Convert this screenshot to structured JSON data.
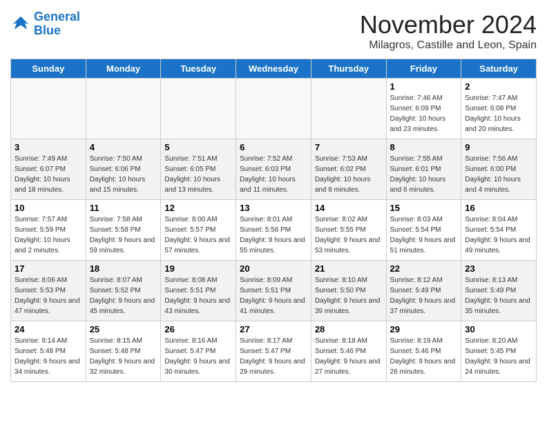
{
  "header": {
    "logo_line1": "General",
    "logo_line2": "Blue",
    "month": "November 2024",
    "location": "Milagros, Castille and Leon, Spain"
  },
  "weekdays": [
    "Sunday",
    "Monday",
    "Tuesday",
    "Wednesday",
    "Thursday",
    "Friday",
    "Saturday"
  ],
  "weeks": [
    {
      "shaded": false,
      "days": [
        {
          "number": "",
          "info": ""
        },
        {
          "number": "",
          "info": ""
        },
        {
          "number": "",
          "info": ""
        },
        {
          "number": "",
          "info": ""
        },
        {
          "number": "",
          "info": ""
        },
        {
          "number": "1",
          "info": "Sunrise: 7:46 AM\nSunset: 6:09 PM\nDaylight: 10 hours and 23 minutes."
        },
        {
          "number": "2",
          "info": "Sunrise: 7:47 AM\nSunset: 6:08 PM\nDaylight: 10 hours and 20 minutes."
        }
      ]
    },
    {
      "shaded": true,
      "days": [
        {
          "number": "3",
          "info": "Sunrise: 7:49 AM\nSunset: 6:07 PM\nDaylight: 10 hours and 18 minutes."
        },
        {
          "number": "4",
          "info": "Sunrise: 7:50 AM\nSunset: 6:06 PM\nDaylight: 10 hours and 15 minutes."
        },
        {
          "number": "5",
          "info": "Sunrise: 7:51 AM\nSunset: 6:05 PM\nDaylight: 10 hours and 13 minutes."
        },
        {
          "number": "6",
          "info": "Sunrise: 7:52 AM\nSunset: 6:03 PM\nDaylight: 10 hours and 11 minutes."
        },
        {
          "number": "7",
          "info": "Sunrise: 7:53 AM\nSunset: 6:02 PM\nDaylight: 10 hours and 8 minutes."
        },
        {
          "number": "8",
          "info": "Sunrise: 7:55 AM\nSunset: 6:01 PM\nDaylight: 10 hours and 6 minutes."
        },
        {
          "number": "9",
          "info": "Sunrise: 7:56 AM\nSunset: 6:00 PM\nDaylight: 10 hours and 4 minutes."
        }
      ]
    },
    {
      "shaded": false,
      "days": [
        {
          "number": "10",
          "info": "Sunrise: 7:57 AM\nSunset: 5:59 PM\nDaylight: 10 hours and 2 minutes."
        },
        {
          "number": "11",
          "info": "Sunrise: 7:58 AM\nSunset: 5:58 PM\nDaylight: 9 hours and 59 minutes."
        },
        {
          "number": "12",
          "info": "Sunrise: 8:00 AM\nSunset: 5:57 PM\nDaylight: 9 hours and 57 minutes."
        },
        {
          "number": "13",
          "info": "Sunrise: 8:01 AM\nSunset: 5:56 PM\nDaylight: 9 hours and 55 minutes."
        },
        {
          "number": "14",
          "info": "Sunrise: 8:02 AM\nSunset: 5:55 PM\nDaylight: 9 hours and 53 minutes."
        },
        {
          "number": "15",
          "info": "Sunrise: 8:03 AM\nSunset: 5:54 PM\nDaylight: 9 hours and 51 minutes."
        },
        {
          "number": "16",
          "info": "Sunrise: 8:04 AM\nSunset: 5:54 PM\nDaylight: 9 hours and 49 minutes."
        }
      ]
    },
    {
      "shaded": true,
      "days": [
        {
          "number": "17",
          "info": "Sunrise: 8:06 AM\nSunset: 5:53 PM\nDaylight: 9 hours and 47 minutes."
        },
        {
          "number": "18",
          "info": "Sunrise: 8:07 AM\nSunset: 5:52 PM\nDaylight: 9 hours and 45 minutes."
        },
        {
          "number": "19",
          "info": "Sunrise: 8:08 AM\nSunset: 5:51 PM\nDaylight: 9 hours and 43 minutes."
        },
        {
          "number": "20",
          "info": "Sunrise: 8:09 AM\nSunset: 5:51 PM\nDaylight: 9 hours and 41 minutes."
        },
        {
          "number": "21",
          "info": "Sunrise: 8:10 AM\nSunset: 5:50 PM\nDaylight: 9 hours and 39 minutes."
        },
        {
          "number": "22",
          "info": "Sunrise: 8:12 AM\nSunset: 5:49 PM\nDaylight: 9 hours and 37 minutes."
        },
        {
          "number": "23",
          "info": "Sunrise: 8:13 AM\nSunset: 5:49 PM\nDaylight: 9 hours and 35 minutes."
        }
      ]
    },
    {
      "shaded": false,
      "days": [
        {
          "number": "24",
          "info": "Sunrise: 8:14 AM\nSunset: 5:48 PM\nDaylight: 9 hours and 34 minutes."
        },
        {
          "number": "25",
          "info": "Sunrise: 8:15 AM\nSunset: 5:48 PM\nDaylight: 9 hours and 32 minutes."
        },
        {
          "number": "26",
          "info": "Sunrise: 8:16 AM\nSunset: 5:47 PM\nDaylight: 9 hours and 30 minutes."
        },
        {
          "number": "27",
          "info": "Sunrise: 8:17 AM\nSunset: 5:47 PM\nDaylight: 9 hours and 29 minutes."
        },
        {
          "number": "28",
          "info": "Sunrise: 8:18 AM\nSunset: 5:46 PM\nDaylight: 9 hours and 27 minutes."
        },
        {
          "number": "29",
          "info": "Sunrise: 8:19 AM\nSunset: 5:46 PM\nDaylight: 9 hours and 26 minutes."
        },
        {
          "number": "30",
          "info": "Sunrise: 8:20 AM\nSunset: 5:45 PM\nDaylight: 9 hours and 24 minutes."
        }
      ]
    }
  ]
}
